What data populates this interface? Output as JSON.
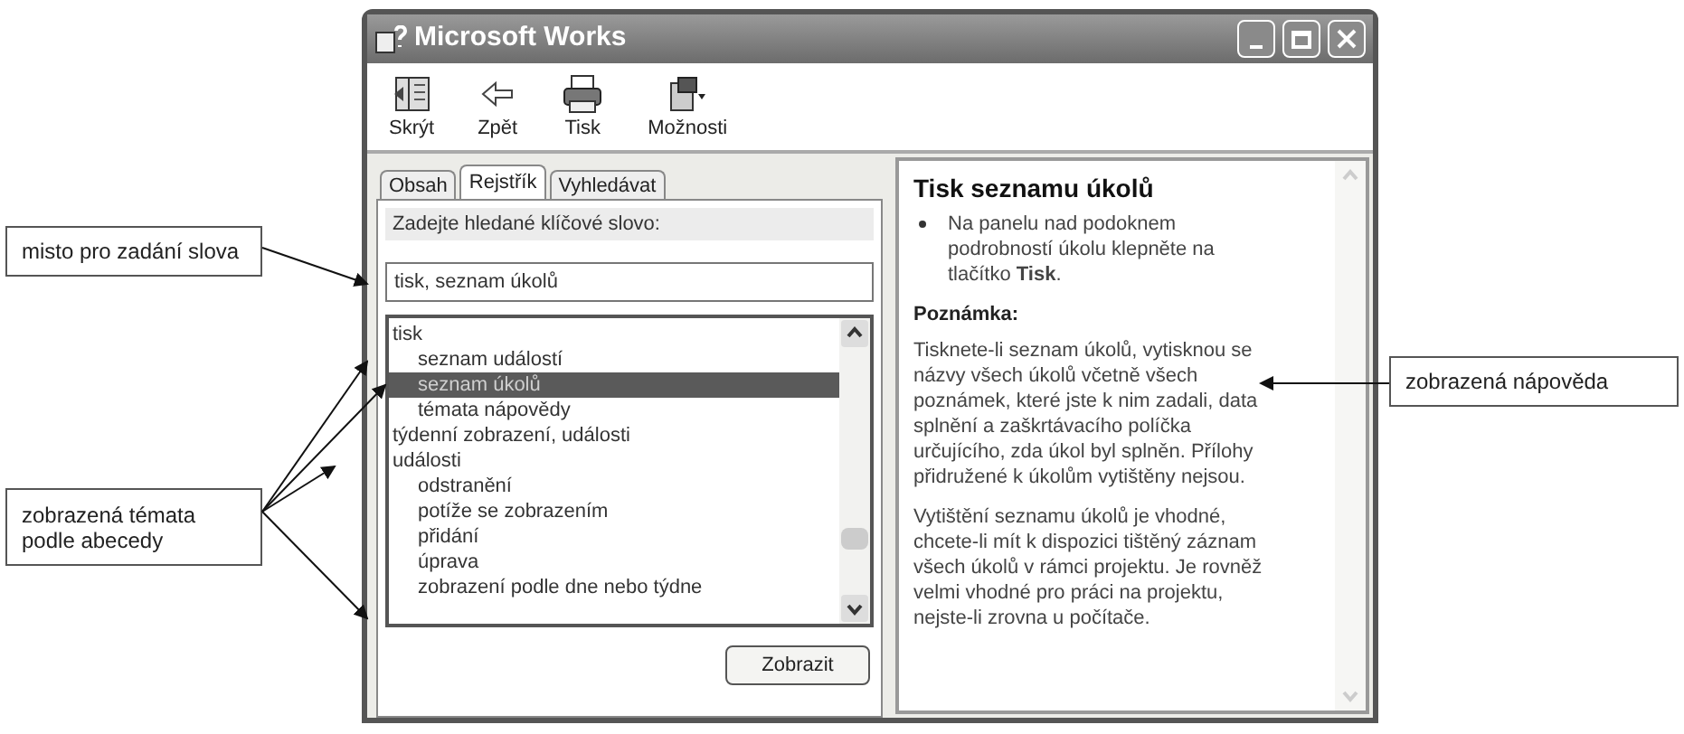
{
  "window": {
    "title": "Microsoft Works"
  },
  "toolbar": [
    {
      "label": "Skrýt",
      "kind": "hide"
    },
    {
      "label": "Zpět",
      "kind": "back"
    },
    {
      "label": "Tisk",
      "kind": "print"
    },
    {
      "label": "Možnosti",
      "kind": "options"
    }
  ],
  "tabs": [
    {
      "label": "Obsah",
      "selected": false
    },
    {
      "label": "Rejstřík",
      "selected": true
    },
    {
      "label": "Vyhledávat",
      "selected": false
    }
  ],
  "keyword_label": "Zadejte hledané klíčové slovo:",
  "keyword_field": {
    "value": "tisk, seznam úkolů"
  },
  "index_list": [
    {
      "label": "tisk",
      "selected": false,
      "children": [
        {
          "label": "seznam událostí",
          "selected": false
        },
        {
          "label": "seznam úkolů",
          "selected": true
        },
        {
          "label": "témata nápovědy",
          "selected": false
        }
      ]
    },
    {
      "label": "týdenní zobrazení, události",
      "selected": false
    },
    {
      "label": "události",
      "selected": false,
      "children": [
        {
          "label": "odstranění",
          "selected": false
        },
        {
          "label": "potíže se zobrazením",
          "selected": false
        },
        {
          "label": "přidání",
          "selected": false
        },
        {
          "label": "úprava",
          "selected": false
        },
        {
          "label": "zobrazení podle dne nebo týdne",
          "selected": false
        }
      ]
    }
  ],
  "show_button": "Zobrazit",
  "topic": {
    "title": "Tisk seznamu úkolů",
    "bullets": [
      "Na panelu nad podoknem podrobností úkolu klepněte na tlačítko **Tisk**."
    ],
    "note_heading": "Poznámka:",
    "paragraphs": [
      "Tisknete-li seznam úkolů, vytisknou se názvy všech úkolů včetně všech poznámek, které jste k nim zadali, data splnění a zaškrtávacího políčka určujícího, zda úkol byl splněn. Přílohy přidružené k úkolům vytištěny nejsou.",
      "Vytištění seznamu úkolů je vhodné, chcete-li mít k dispozici tištěný záznam všech úkolů v rámci projektu. Je rovněž velmi vhodné pro práci na projektu, nejste-li zrovna u počítače."
    ]
  },
  "callouts": [
    {
      "text": "misto pro zadání slova"
    },
    {
      "text": "zobrazená témata podle abecedy"
    },
    {
      "text": "zobrazená nápověda"
    }
  ]
}
